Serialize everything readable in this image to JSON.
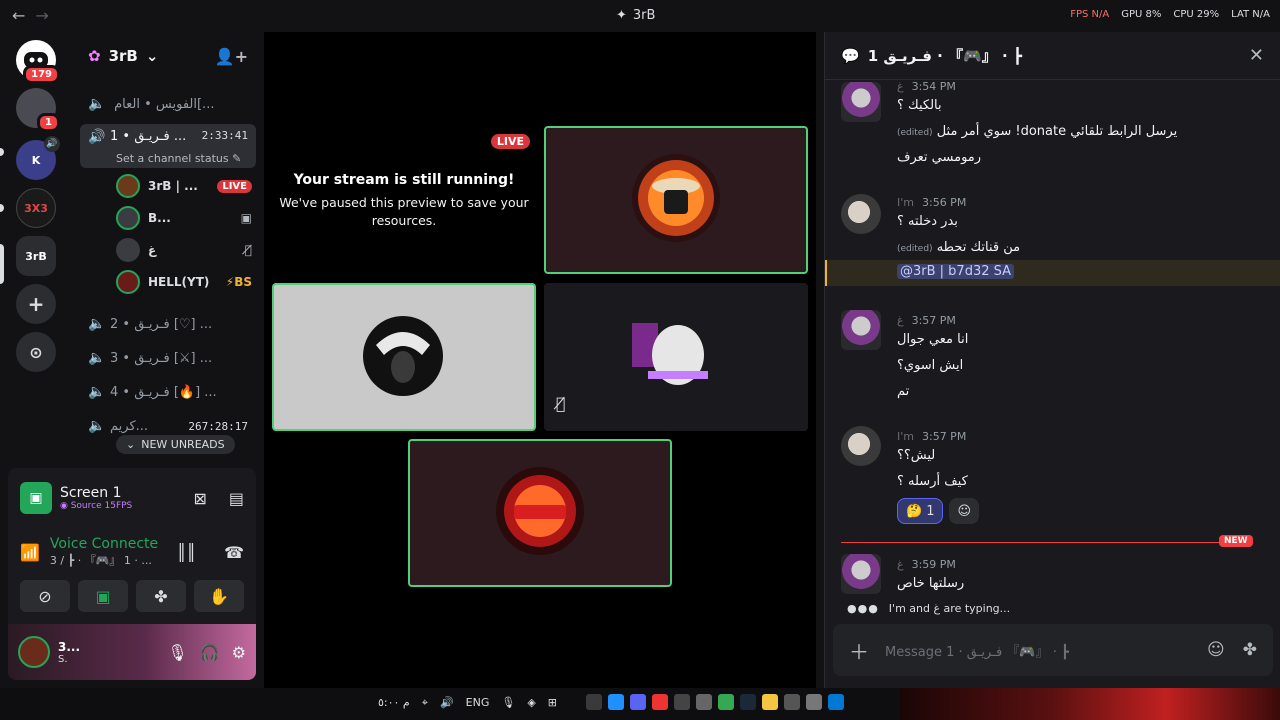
{
  "topbar": {
    "back": "←",
    "forward": "→",
    "title": "3rB",
    "stats": [
      "FPS N/A",
      "GPU 8%",
      "CPU 29%",
      "LAT N/A"
    ]
  },
  "rail": {
    "badge_top": "179",
    "badge_second": "1",
    "srv_3rb": "3rB",
    "srv_3x3": "3X3",
    "add": "+",
    "discover": "⊙"
  },
  "sidebar": {
    "server_name": "3rB",
    "channels": [
      {
        "label": "‏الفويس • العام ‏[..."
      },
      {
        "label": "‏فـريـق • 1 ...",
        "timer": "2:33:41",
        "status": "Set a channel status ✎"
      },
      {
        "label": "‏فـريـق • 2 [♡] ..."
      },
      {
        "label": "‏فـريـق • 3 [⚔] ..."
      },
      {
        "label": "‏فـريـق • 4 [🔥] ..."
      },
      {
        "label": "‏كريم...",
        "timer": "267:28:17"
      }
    ],
    "voice_users": [
      {
        "name": "3rB | ...",
        "live": "LIVE"
      },
      {
        "name": "B...",
        "tail": "▣"
      },
      {
        "name": "غ",
        "tail": "🎙̸"
      },
      {
        "name": "HELL(YT)",
        "tail": "⚡BS"
      }
    ],
    "new_unreads": "NEW UNREADS"
  },
  "voice_panel": {
    "screen_title": "Screen 1",
    "screen_sub": "◉ Source 15FPS",
    "vc_title": "Voice Connecte",
    "vc_sub": "3 / ┣ · 『🎮』 1 · ...",
    "user_name": "3...",
    "user_status": "S."
  },
  "stage": {
    "live_badge": "LIVE",
    "paused_title": "Your stream is still running!",
    "paused_text": "We've paused this preview to save your resources."
  },
  "thread": {
    "title": "فـريـق 1 · 『🎮』 · ┣",
    "messages": [
      {
        "name": "غ",
        "time": "3:54 PM",
        "lines": [
          "بالكيك ؟",
          "سوي أمر مثل !donate يرسل الرابط تلقائي",
          "رمومسي تعرف"
        ],
        "edited_index": 1
      },
      {
        "name": "I'm",
        "time": "3:56 PM",
        "lines": [
          "بدر دخلته ؟",
          "من قناتك تحطه"
        ],
        "edited_index": 1,
        "mention": "@3rB | b7d32 SA"
      },
      {
        "name": "غ",
        "time": "3:57 PM",
        "lines": [
          "انا معي جوال",
          "ايش اسوي؟",
          "تم"
        ]
      },
      {
        "name": "I'm",
        "time": "3:57 PM",
        "lines": [
          "ليش؟؟",
          "كيف أرسله ؟"
        ],
        "reaction_count": "1"
      },
      {
        "name": "غ",
        "time": "3:59 PM",
        "lines": [
          "رسلتها خاص"
        ]
      }
    ],
    "edited_label": "(edited)",
    "new_label": "NEW",
    "typing": "I'm and غ are typing...",
    "composer_placeholder": "Message 1 · فـريـق 『🎮』 · ┣"
  },
  "taskbar": {
    "lang": "ENG",
    "time_hint": "م ٥:٠٠"
  },
  "colors": {
    "accent_green": "#23a55a",
    "live_red": "#da373c",
    "speaking_border": "#4ed17a"
  }
}
